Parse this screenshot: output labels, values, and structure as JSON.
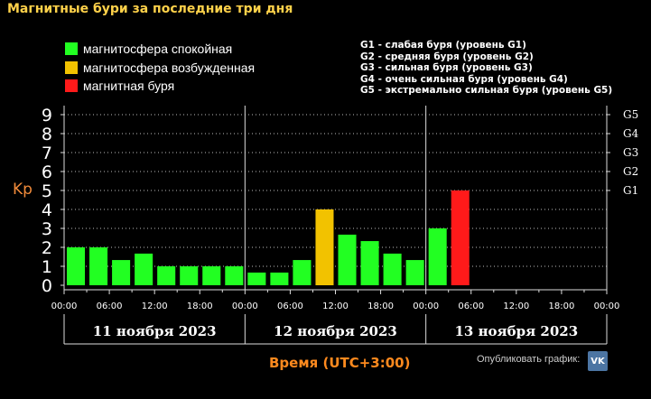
{
  "title": "Магнитные бури за последние три дня",
  "legend": {
    "quiet": {
      "label": "магнитосфера спокойная",
      "color": "#22ff22"
    },
    "excited": {
      "label": "магнитосфера возбужденная",
      "color": "#f2c200"
    },
    "storm": {
      "label": "магнитная буря",
      "color": "#ff1a1a"
    }
  },
  "g_scale": [
    "G1 - слабая буря (уровень G1)",
    "G2 - средняя буря (уровень G2)",
    "G3 - сильная буря (уровень G3)",
    "G4 - очень сильная буря (уровень G4)",
    "G5 - экстремально сильная буря (уровень G5)"
  ],
  "chart_data": {
    "type": "bar",
    "ylabel": "Kp",
    "ylim": [
      0,
      9
    ],
    "y_ticks": [
      "0",
      "1",
      "2",
      "3",
      "4",
      "5",
      "6",
      "7",
      "8",
      "9"
    ],
    "g_ticks": [
      {
        "label": "G1",
        "y": 5
      },
      {
        "label": "G2",
        "y": 6
      },
      {
        "label": "G3",
        "y": 7
      },
      {
        "label": "G4",
        "y": 8
      },
      {
        "label": "G5",
        "y": 9
      }
    ],
    "x_tick_labels": [
      "00:00",
      "06:00",
      "12:00",
      "18:00",
      "00:00",
      "06:00",
      "12:00",
      "18:00",
      "00:00",
      "06:00",
      "12:00",
      "18:00",
      "00:00"
    ],
    "days": [
      "11 ноября 2023",
      "12 ноября 2023",
      "13 ноября 2023"
    ],
    "xlabel": "Время (UTC+3:00)",
    "values": [
      2.0,
      2.0,
      1.33,
      1.67,
      1.0,
      1.0,
      1.0,
      1.0,
      0.67,
      0.67,
      1.33,
      4.0,
      2.67,
      2.33,
      1.67,
      1.33,
      3.0,
      5.0
    ],
    "levels": [
      "quiet",
      "quiet",
      "quiet",
      "quiet",
      "quiet",
      "quiet",
      "quiet",
      "quiet",
      "quiet",
      "quiet",
      "quiet",
      "excited",
      "quiet",
      "quiet",
      "quiet",
      "quiet",
      "quiet",
      "storm"
    ],
    "bars_per_day": 8,
    "grid": true
  },
  "footer": {
    "publish_label": "Опубликовать график:",
    "vk_label": "VK"
  }
}
